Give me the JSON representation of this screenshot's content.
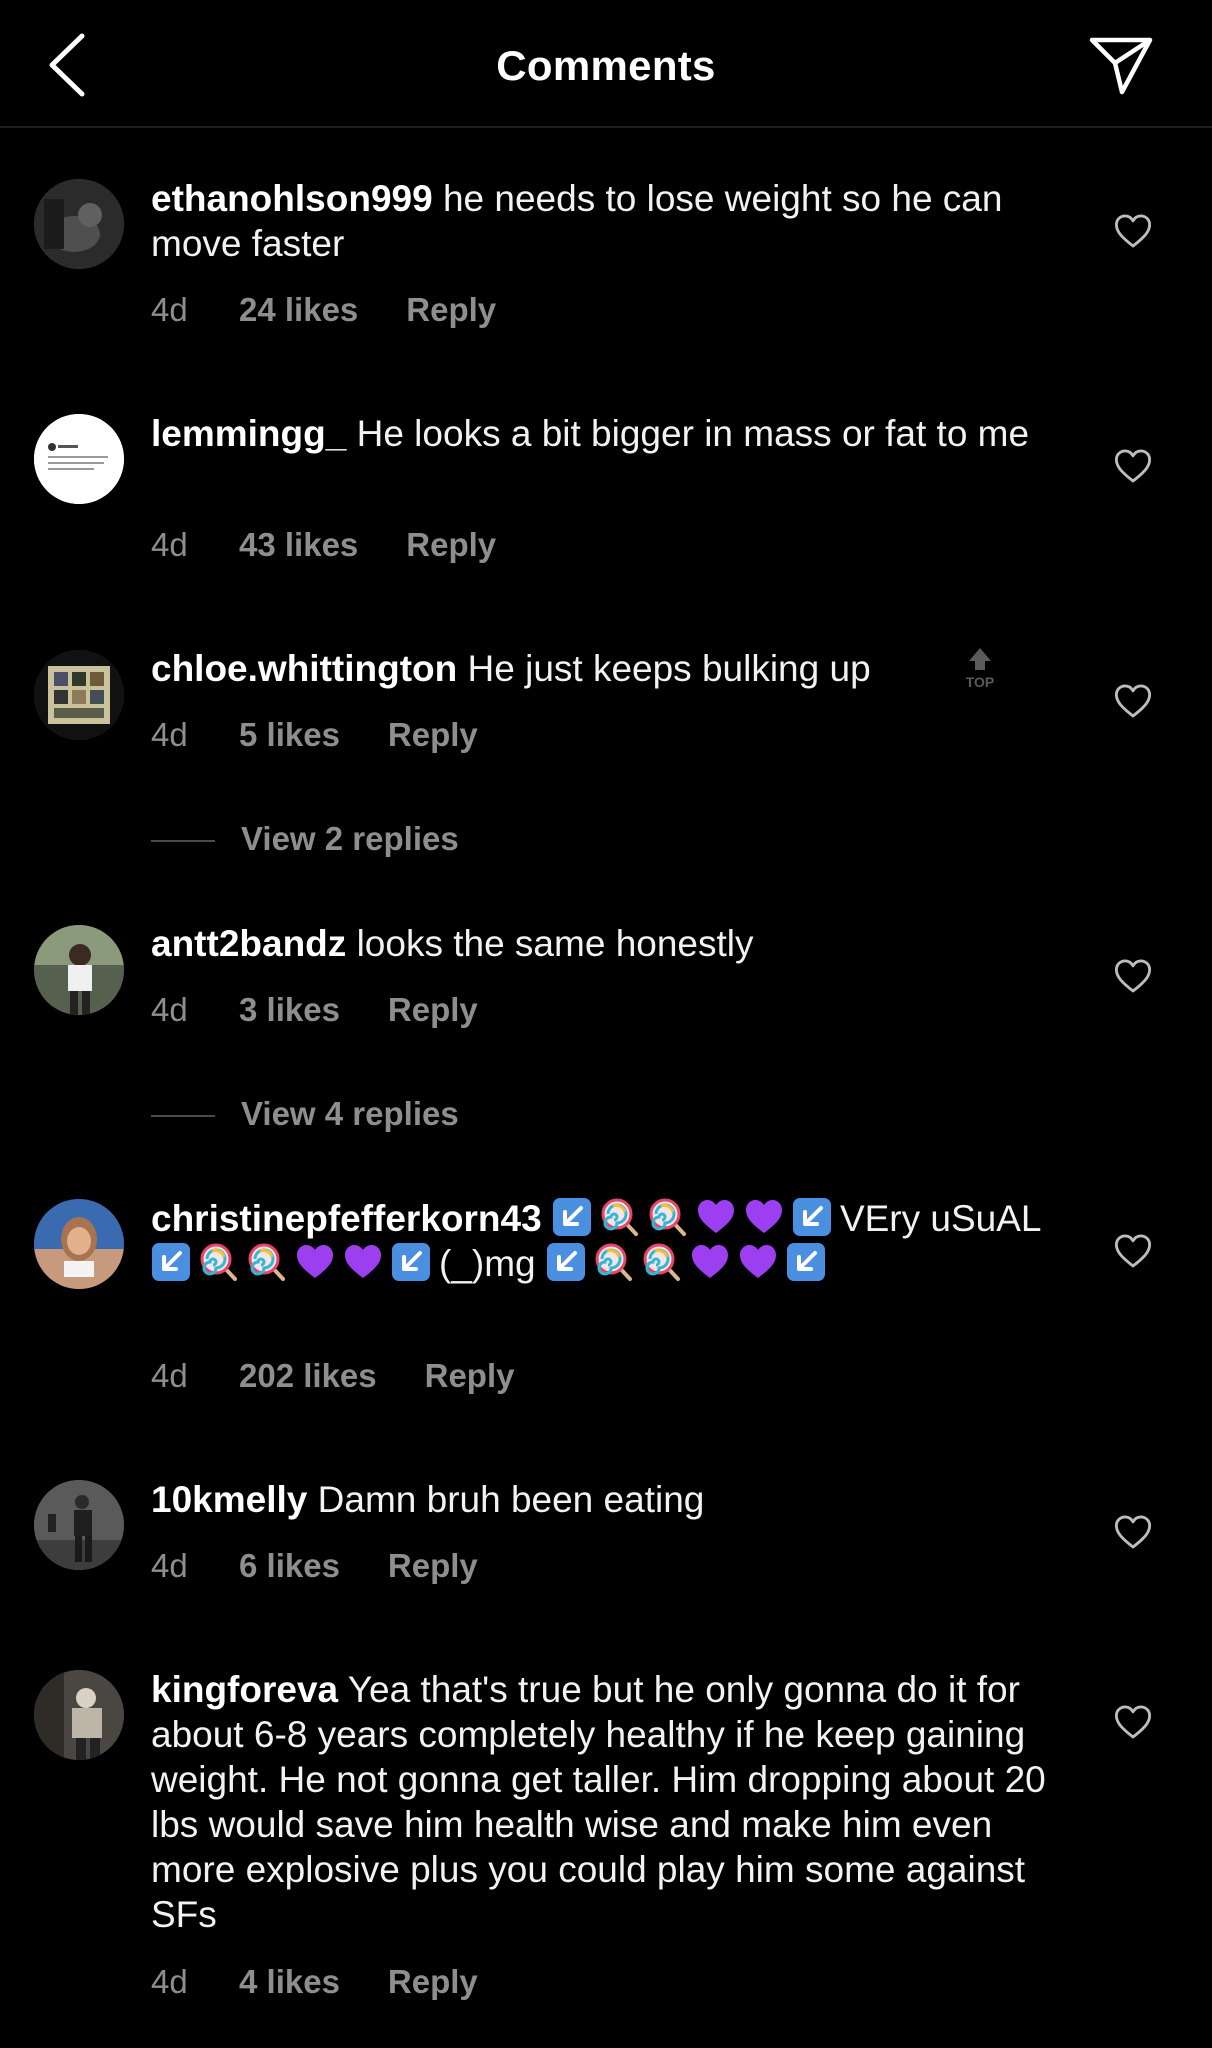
{
  "header": {
    "title": "Comments"
  },
  "icons": {
    "back": "chevron-left-icon",
    "send": "paper-plane-icon",
    "like": "heart-outline-icon"
  },
  "colors": {
    "background": "#000000",
    "meta": "#8e8e8e",
    "emoji_arrow": "#4a8fe0",
    "emoji_heart": "#9b3ff0"
  },
  "comments": [
    {
      "username": "ethanohlson999",
      "text": "he needs to lose weight so he can move faster",
      "age": "4d",
      "likes": "24 likes",
      "reply": "Reply"
    },
    {
      "username": "lemmingg_",
      "text": "He looks a bit bigger in mass or fat to me",
      "age": "4d",
      "likes": "43 likes",
      "reply": "Reply"
    },
    {
      "username": "chloe.whittington",
      "text": "He just keeps bulking up",
      "age": "4d",
      "likes": "5 likes",
      "reply": "Reply",
      "badge": "TOP",
      "view_replies": "View 2 replies"
    },
    {
      "username": "antt2bandz",
      "text": "looks the same honestly",
      "age": "4d",
      "likes": "3 likes",
      "reply": "Reply",
      "view_replies": "View 4 replies"
    },
    {
      "username": "christinepfefferkorn43",
      "text_parts": [
        "VEry",
        "uSuAL",
        "(_)mg"
      ],
      "age": "4d",
      "likes": "202 likes",
      "reply": "Reply"
    },
    {
      "username": "10kmelly",
      "text": "Damn bruh been eating",
      "age": "4d",
      "likes": "6 likes",
      "reply": "Reply"
    },
    {
      "username": "kingforeva",
      "text": "Yea that's true but he only gonna do it for about 6-8 years completely healthy if he keep gaining weight. He not gonna get taller. Him dropping about 20 lbs would save him health wise and make him even more explosive plus you could play him some against SFs",
      "age": "4d",
      "likes": "4 likes",
      "reply": "Reply"
    }
  ]
}
